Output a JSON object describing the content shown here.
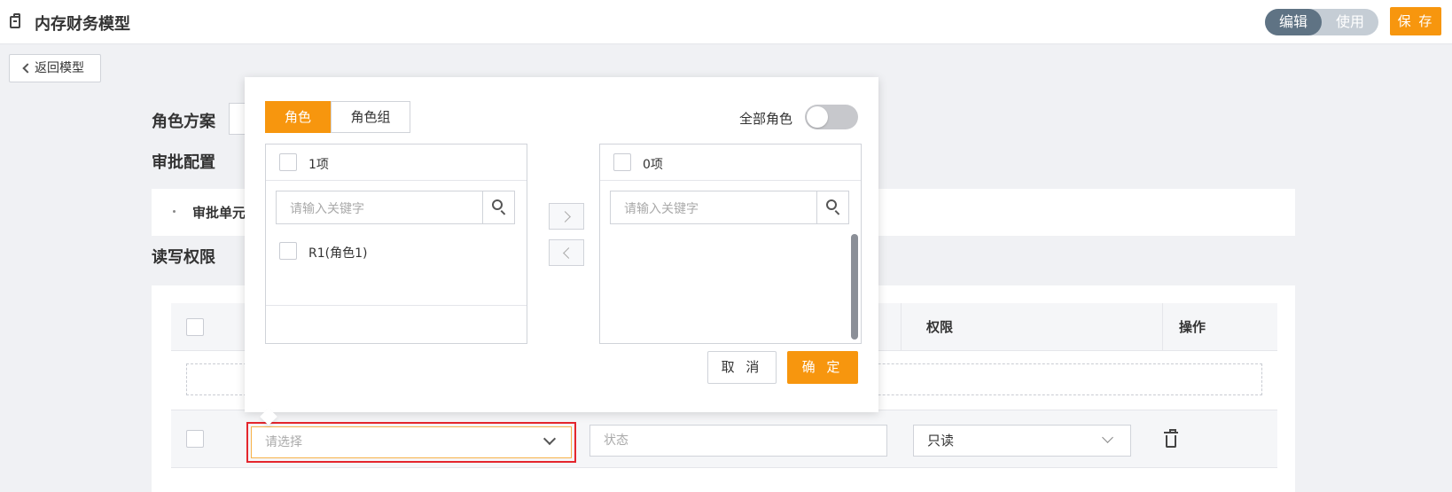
{
  "header": {
    "title": "内存财务模型",
    "mode_edit": "编辑",
    "mode_use": "使用",
    "save": "保 存"
  },
  "back_label": "返回模型",
  "sections": {
    "role_scheme": "角色方案",
    "approval_config": "审批配置",
    "approval_unit": "审批单元",
    "rw_permission": "读写权限"
  },
  "table": {
    "headers": {
      "permission": "权限",
      "action": "操作"
    },
    "row": {
      "role_placeholder": "请选择",
      "status_placeholder": "状态",
      "permission_value": "只读"
    }
  },
  "modal": {
    "tabs": [
      "角色",
      "角色组"
    ],
    "all_roles_label": "全部角色",
    "all_roles_on": false,
    "left": {
      "count": "1项",
      "search_placeholder": "请输入关键字",
      "items": [
        "R1(角色1)"
      ]
    },
    "right": {
      "count": "0项",
      "search_placeholder": "请输入关键字"
    },
    "cancel": "取 消",
    "confirm": "确 定"
  },
  "colors": {
    "accent": "#f7960e",
    "highlight": "#e4262d",
    "toggle_active": "#5f7384"
  }
}
